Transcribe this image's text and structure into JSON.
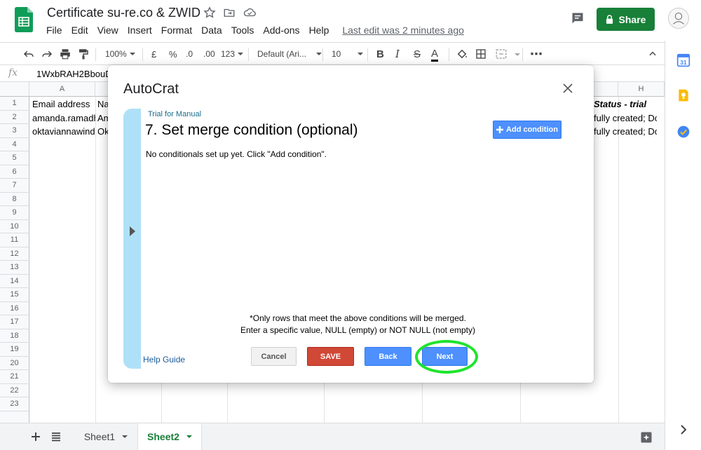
{
  "header": {
    "title": "Certificate su-re.co & ZWID",
    "menu": [
      "File",
      "Edit",
      "View",
      "Insert",
      "Format",
      "Data",
      "Tools",
      "Add-ons",
      "Help"
    ],
    "last_edit": "Last edit was 2 minutes ago",
    "share_label": "Share"
  },
  "toolbar": {
    "zoom": "100%",
    "currency": "£",
    "percent": "%",
    "dec_decrease": ".0",
    "dec_increase": ".00",
    "more_formats": "123",
    "font": "Default (Ari...",
    "font_size": "10",
    "bold": "B",
    "italic": "I",
    "strike": "S",
    "text_color": "A",
    "more": "⋯"
  },
  "formula_bar": {
    "fx": "fx",
    "content": "1WxbRAH2BbouD3"
  },
  "grid": {
    "columns": [
      "A",
      "H"
    ],
    "rows": [
      "1",
      "2",
      "3",
      "4",
      "5",
      "6",
      "7",
      "8",
      "9",
      "10",
      "11",
      "12",
      "13",
      "14",
      "15",
      "16",
      "17",
      "18",
      "19",
      "20",
      "21",
      "22",
      "23"
    ],
    "cells": {
      "a1": "Email address",
      "b1": "Na",
      "a2": "amanda.ramadha",
      "b2": "Am",
      "a3": "oktaviannawinda",
      "b3": "Ok",
      "g1": "Status - trial",
      "g2": "fully created; Do",
      "g3": "fully created; Do"
    }
  },
  "sheets": {
    "tabs": [
      "Sheet1",
      "Sheet2"
    ],
    "active": "Sheet2"
  },
  "dialog": {
    "title": "AutoCrat",
    "breadcrumb": "Trial for Manual",
    "heading": "7. Set merge condition (optional)",
    "add_condition_label": "Add condition",
    "empty_text": "No conditionals set up yet. Click \"Add condition\".",
    "note_line1": "*Only rows that meet the above conditions will be merged.",
    "note_line2": "Enter a specific value, NULL (empty) or NOT NULL (not empty)",
    "help_link": "Help Guide",
    "buttons": {
      "cancel": "Cancel",
      "save": "SAVE",
      "back": "Back",
      "next": "Next"
    }
  },
  "colors": {
    "share_green": "#188038",
    "save_red": "#d14836",
    "primary_blue": "#4d90fe",
    "rail_blue": "#aee1f8",
    "highlight_green": "#1fe42c"
  },
  "icons": {
    "star": "star-icon",
    "move": "move-to-folder-icon",
    "cloud": "cloud-saved-icon",
    "comment": "comment-icon",
    "lock": "lock-icon",
    "close": "close-icon",
    "plus": "plus-icon"
  }
}
